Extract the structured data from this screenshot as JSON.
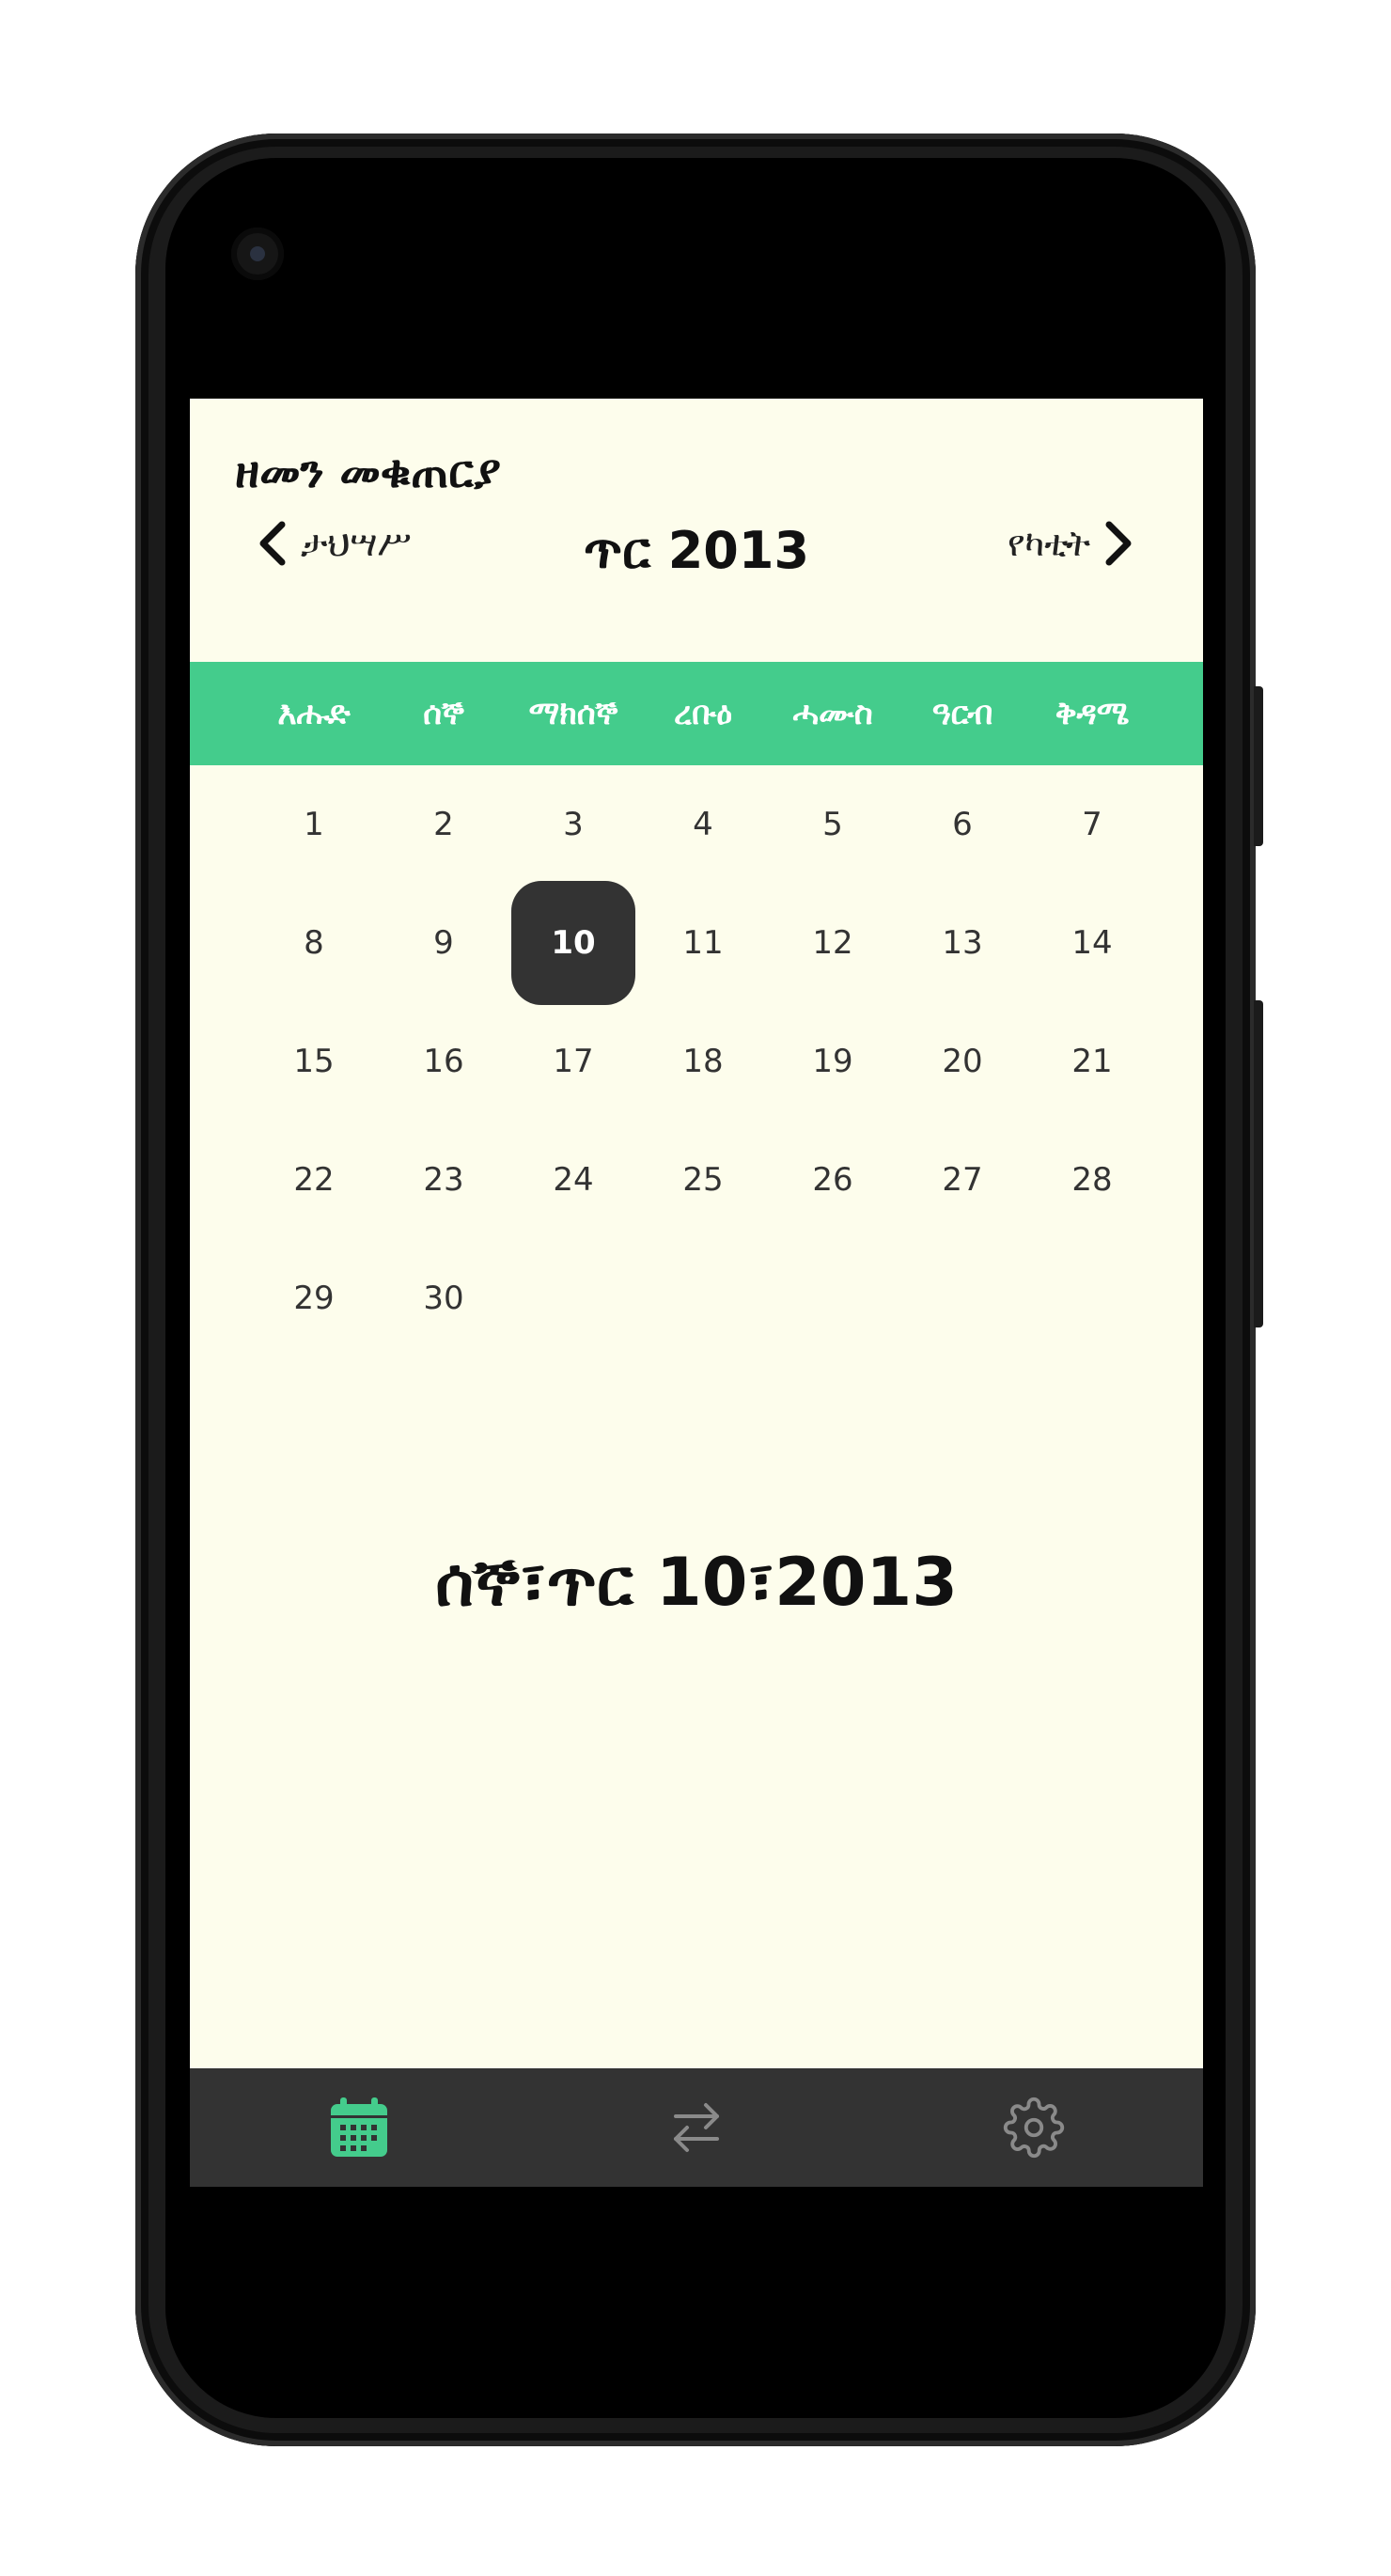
{
  "app": {
    "title": "ዘመን መቁጠርያ"
  },
  "header": {
    "prev_label": "ታህሣሥ",
    "next_label": "የካቲት",
    "month_title": "ጥር 2013"
  },
  "weekdays": [
    "እሑድ",
    "ሰኞ",
    "ማክሰኞ",
    "ረቡዕ",
    "ሓሙስ",
    "ዓርብ",
    "ቅዳሜ"
  ],
  "days": [
    "1",
    "2",
    "3",
    "4",
    "5",
    "6",
    "7",
    "8",
    "9",
    "10",
    "11",
    "12",
    "13",
    "14",
    "15",
    "16",
    "17",
    "18",
    "19",
    "20",
    "21",
    "22",
    "23",
    "24",
    "25",
    "26",
    "27",
    "28",
    "29",
    "30"
  ],
  "selected_day": "10",
  "selected_date_text": "ሰኞ፣ጥር 10፣2013",
  "bottom_nav": [
    {
      "icon": "calendar-icon",
      "active": true
    },
    {
      "icon": "swap-arrows-icon",
      "active": false
    },
    {
      "icon": "gear-icon",
      "active": false
    }
  ],
  "colors": {
    "accent": "#44cc8c",
    "background": "#fdfdec",
    "selected": "#333333",
    "bottom_bar": "#333333",
    "inactive_icon": "#8a8a8a"
  }
}
